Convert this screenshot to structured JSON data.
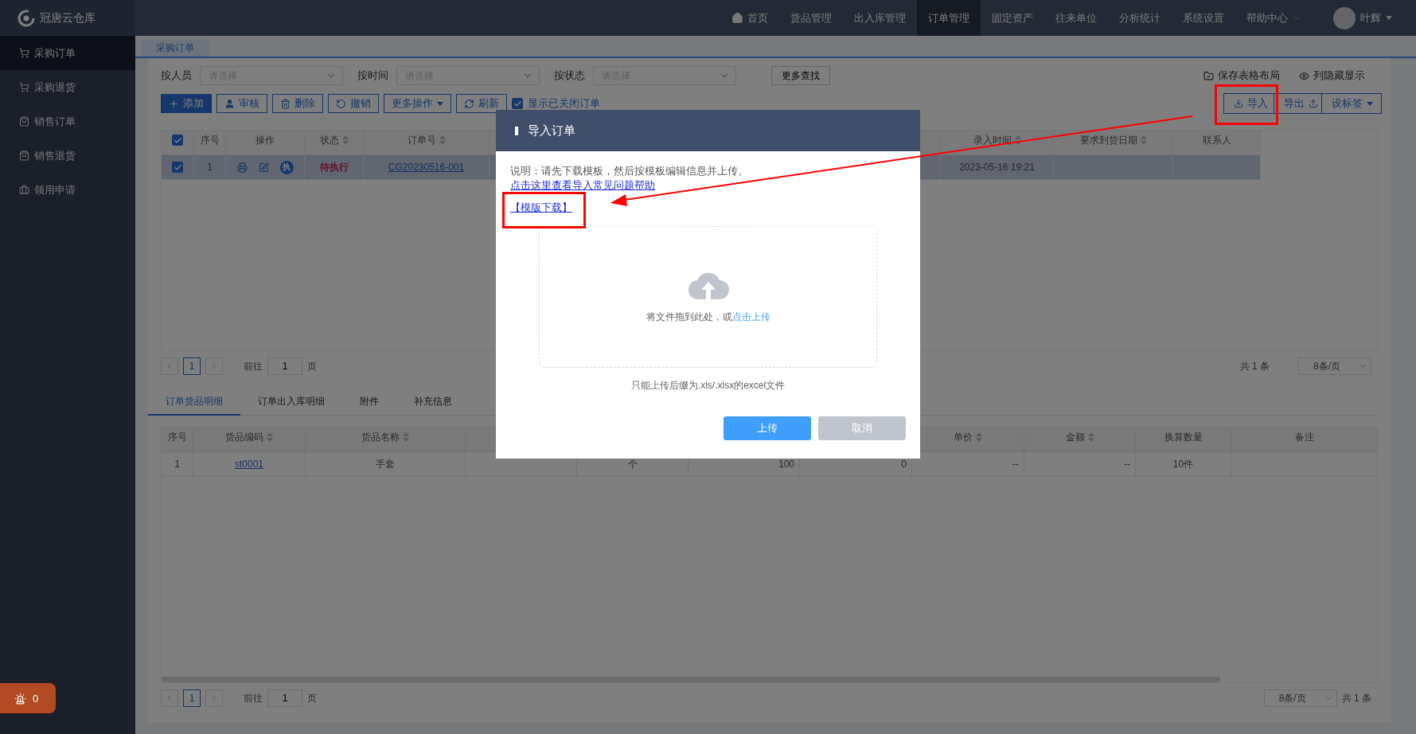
{
  "app": {
    "name": "冠唐云仓库"
  },
  "nav": {
    "items": [
      {
        "label": "首页",
        "kind": "home",
        "selected": false
      },
      {
        "label": "货品管理",
        "kind": "plain",
        "selected": false
      },
      {
        "label": "出入库管理",
        "kind": "plain",
        "selected": false
      },
      {
        "label": "订单管理",
        "kind": "plain",
        "selected": true
      },
      {
        "label": "固定资产",
        "kind": "plain",
        "selected": false
      },
      {
        "label": "往来单位",
        "kind": "plain",
        "selected": false
      },
      {
        "label": "分析统计",
        "kind": "plain",
        "selected": false
      },
      {
        "label": "系统设置",
        "kind": "plain",
        "selected": false
      },
      {
        "label": "帮助中心",
        "kind": "dropdown",
        "selected": false
      }
    ],
    "user": {
      "name": "叶辉"
    }
  },
  "sidebar": {
    "items": [
      {
        "label": "采购订单",
        "kind": "cart",
        "selected": true
      },
      {
        "label": "采购退货",
        "kind": "cart",
        "selected": false
      },
      {
        "label": "销售订单",
        "kind": "bag",
        "selected": false
      },
      {
        "label": "销售退货",
        "kind": "bag",
        "selected": false
      },
      {
        "label": "领用申请",
        "kind": "case",
        "selected": false
      }
    ]
  },
  "alarm_badge": {
    "count": "0"
  },
  "page_tab": {
    "label": "采购订单",
    "selected": true
  },
  "filters": [
    {
      "label": "按人员",
      "placeholder": "请选择"
    },
    {
      "label": "按时间",
      "placeholder": "请选择"
    },
    {
      "label": "按状态",
      "placeholder": "请选择"
    }
  ],
  "more_search": "更多查找",
  "table_links": [
    {
      "label": "保存表格布局",
      "kind": "folder"
    },
    {
      "label": "列隐藏显示",
      "kind": "eye"
    }
  ],
  "toolbar": [
    {
      "label": "添加",
      "kind": "add"
    },
    {
      "label": "审核",
      "kind": "approve"
    },
    {
      "label": "删除",
      "kind": "delete"
    },
    {
      "label": "撤销",
      "kind": "undo"
    },
    {
      "label": "更多操作",
      "kind": "more"
    },
    {
      "label": "刷新",
      "kind": "refresh"
    }
  ],
  "show_closed": {
    "label": "显示已关闭订单",
    "checked": true
  },
  "right_buttons": [
    {
      "label": "导入",
      "kind": "import"
    },
    {
      "label": "导出",
      "kind": "export"
    },
    {
      "label": "设标签",
      "kind": "dropdown"
    }
  ],
  "orders": {
    "select_all": true,
    "columns": [
      {
        "label": "序号",
        "sortable": false
      },
      {
        "label": "操作",
        "sortable": false
      },
      {
        "label": "状态",
        "sortable": true
      },
      {
        "label": "订单号",
        "sortable": true
      },
      {
        "label": "录入时间",
        "sortable": true
      },
      {
        "label": "要求到货日期",
        "sortable": true
      },
      {
        "label": "联系人",
        "sortable": false
      }
    ],
    "rows": [
      {
        "checked": true,
        "index": "1",
        "execute_badge": "执",
        "status": "待执行",
        "order_no": "CG20230516-001",
        "entered": "2023-05-16 19:21"
      }
    ]
  },
  "orders_pager": {
    "kind": "total_first",
    "pages": [
      {
        "label": "1",
        "selected": true
      }
    ],
    "goto_label": "前往",
    "goto_value": "1",
    "page_suffix": "页",
    "total": "共 1 条",
    "page_size": "8条/页"
  },
  "detail_tabs": [
    {
      "label": "订单货品明细",
      "selected": true
    },
    {
      "label": "订单出入库明细",
      "selected": false
    },
    {
      "label": "附件",
      "selected": false
    },
    {
      "label": "补充信息",
      "selected": false
    }
  ],
  "details": {
    "columns": [
      {
        "label": "序号",
        "sortable": false
      },
      {
        "label": "货品编码",
        "sortable": true
      },
      {
        "label": "货品名称",
        "sortable": true
      },
      {
        "label": "单价",
        "sortable": true
      },
      {
        "label": "金额",
        "sortable": true
      },
      {
        "label": "换算数量",
        "sortable": false
      },
      {
        "label": "备注",
        "sortable": false
      }
    ],
    "rows": [
      {
        "index": "1",
        "code": "st0001",
        "name": "手套",
        "column_5": "个",
        "column_6": "100",
        "column_7": "0",
        "price": "--",
        "amount": "--",
        "converted": "10件"
      }
    ]
  },
  "details_pager": {
    "kind": "size_first",
    "pages": [
      {
        "label": "1",
        "selected": true
      }
    ],
    "goto_label": "前往",
    "goto_value": "1",
    "page_suffix": "页",
    "total": "共 1 条",
    "page_size": "8条/页"
  },
  "dialog": {
    "title": "导入订单",
    "note": "说明：请先下载模板，然后按模板编辑信息并上传。",
    "help_link": "点击这里查看导入常见问题帮助",
    "template_link": "【模版下载】",
    "drop_text": "将文件拖到此处，或",
    "drop_link": "点击上传",
    "hint": "只能上传后缀为.xls/.xlsx的excel文件",
    "buttons": [
      {
        "label": "上传",
        "kind": "primary"
      },
      {
        "label": "取消",
        "kind": "muted"
      }
    ]
  }
}
